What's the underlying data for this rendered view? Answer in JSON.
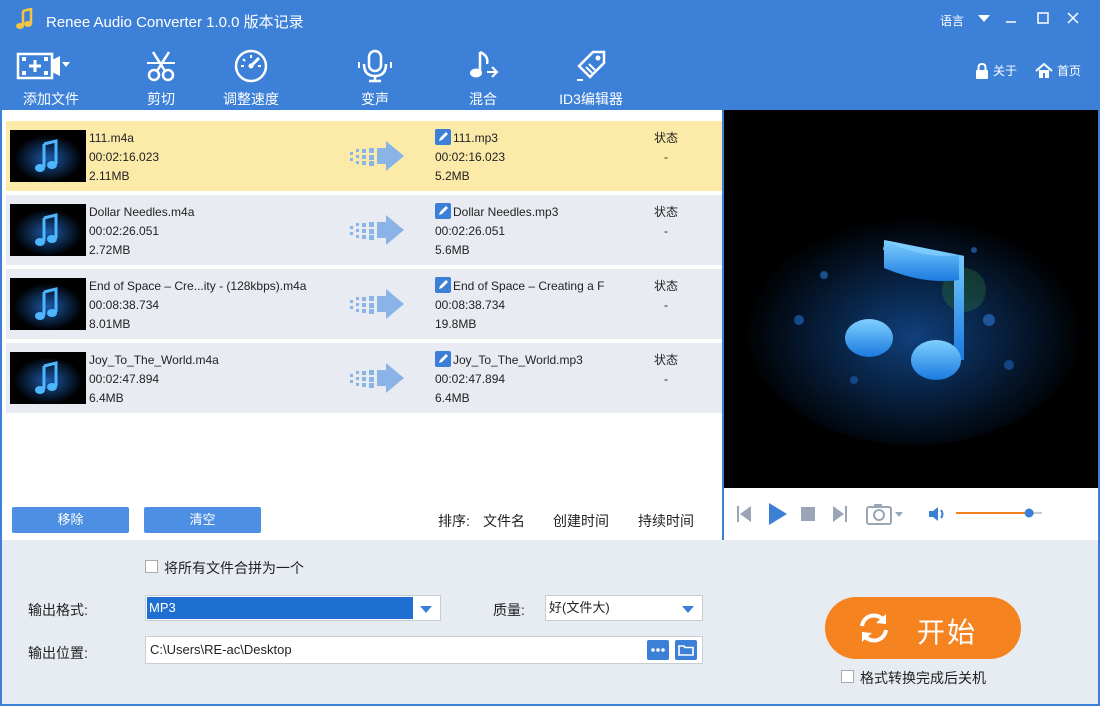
{
  "window": {
    "title": "Renee Audio Converter 1.0.0 版本记录",
    "language": "语言"
  },
  "toolbar": {
    "items": [
      {
        "label": "添加文件"
      },
      {
        "label": "剪切"
      },
      {
        "label": "调整速度"
      },
      {
        "label": "变声"
      },
      {
        "label": "混合"
      },
      {
        "label": "ID3编辑器"
      }
    ],
    "about": "关于",
    "home": "首页"
  },
  "files": [
    {
      "src_name": "111.m4a",
      "src_duration": "00:02:16.023",
      "src_size": "2.11MB",
      "dst_name": "111.mp3",
      "dst_duration": "00:02:16.023",
      "dst_size": "5.2MB",
      "status_label": "状态",
      "status_value": "-"
    },
    {
      "src_name": "Dollar Needles.m4a",
      "src_duration": "00:02:26.051",
      "src_size": "2.72MB",
      "dst_name": "Dollar Needles.mp3",
      "dst_duration": "00:02:26.051",
      "dst_size": "5.6MB",
      "status_label": "状态",
      "status_value": "-"
    },
    {
      "src_name": "End of Space – Cre...ity - (128kbps).m4a",
      "src_duration": "00:08:38.734",
      "src_size": "8.01MB",
      "dst_name": "End of Space – Creating a F",
      "dst_duration": "00:08:38.734",
      "dst_size": "19.8MB",
      "status_label": "状态",
      "status_value": "-"
    },
    {
      "src_name": "Joy_To_The_World.m4a",
      "src_duration": "00:02:47.894",
      "src_size": "6.4MB",
      "dst_name": "Joy_To_The_World.mp3",
      "dst_duration": "00:02:47.894",
      "dst_size": "6.4MB",
      "status_label": "状态",
      "status_value": "-"
    }
  ],
  "list_actions": {
    "remove": "移除",
    "clear": "清空",
    "sort_label": "排序:",
    "sort_name": "文件名",
    "sort_created": "创建时间",
    "sort_duration": "持续时间"
  },
  "output": {
    "merge_label": "将所有文件合拼为一个",
    "format_label": "输出格式:",
    "format_value": "MP3",
    "quality_label": "质量:",
    "quality_value": "好(文件大)",
    "location_label": "输出位置:",
    "location_value": "C:\\Users\\RE-ac\\Desktop"
  },
  "start": {
    "label": "开始",
    "shutdown_label": "格式转换完成后关机"
  },
  "player": {
    "volume": 0.85
  },
  "colors": {
    "accent": "#3d80d8",
    "selected_row": "#fbeaa8",
    "start": "#f5831f"
  }
}
